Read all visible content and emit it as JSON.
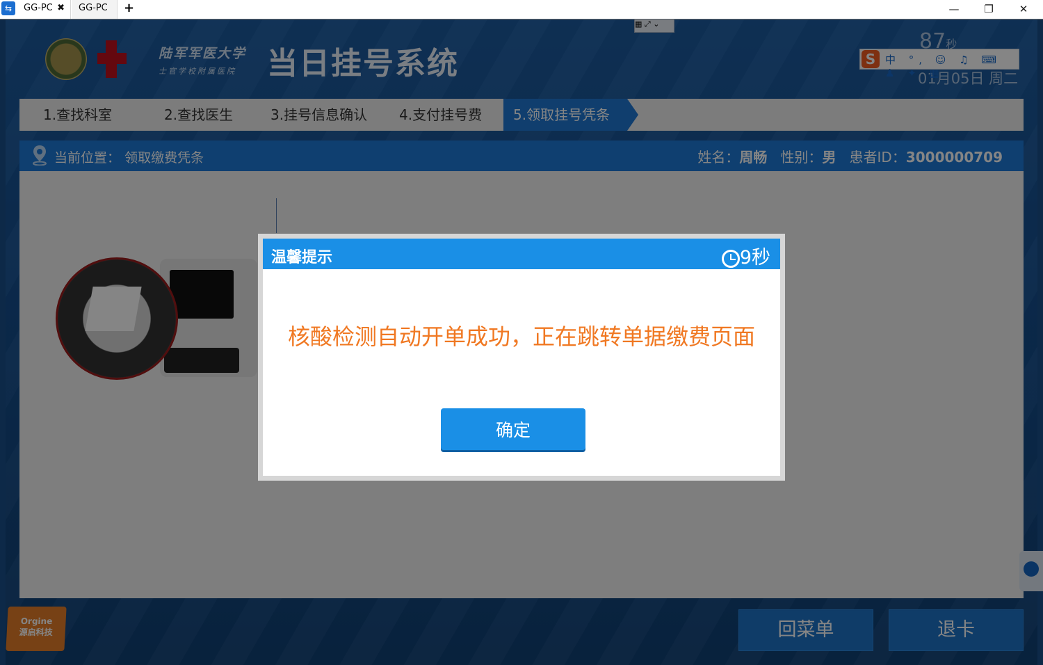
{
  "window": {
    "tabs": [
      {
        "label": "GG-PC",
        "active": true
      },
      {
        "label": "GG-PC",
        "active": false
      }
    ],
    "add_tab": "+",
    "close_tab": "✖",
    "controls": {
      "minimize": "—",
      "restore": "❐",
      "close": "✕"
    }
  },
  "header": {
    "university": "陆军军医大学",
    "hospital": "士官学校附属医院",
    "system_title": "当日挂号系统",
    "countdown": "87",
    "countdown_unit": "秒",
    "date": "01月05日 周二"
  },
  "ime": {
    "logo": "S",
    "text": "中 °, ☺ ♫ ⌨ ♟ ✦ ▦"
  },
  "steps": [
    {
      "label": "1.查找科室",
      "active": false
    },
    {
      "label": "2.查找医生",
      "active": false
    },
    {
      "label": "3.挂号信息确认",
      "active": false
    },
    {
      "label": "4.支付挂号费",
      "active": false
    },
    {
      "label": "5.领取挂号凭条",
      "active": true
    }
  ],
  "location": {
    "prefix": "当前位置：",
    "value": "领取缴费凭条"
  },
  "patient": {
    "name_label": "姓名：",
    "name": "周畅",
    "gender_label": "性别：",
    "gender": "男",
    "id_label": "患者ID：",
    "id": "3000000709"
  },
  "footer": {
    "brand_en": "Orgine",
    "brand_cn": "源启科技",
    "back_menu": "回菜单",
    "eject_card": "退卡"
  },
  "modal": {
    "title": "温馨提示",
    "timer": "9秒",
    "message": "核酸检测自动开单成功，正在跳转单据缴费页面",
    "confirm": "确定"
  },
  "colors": {
    "accent": "#1a8fe6",
    "message": "#f07822",
    "step_active": "#1f77d3"
  }
}
